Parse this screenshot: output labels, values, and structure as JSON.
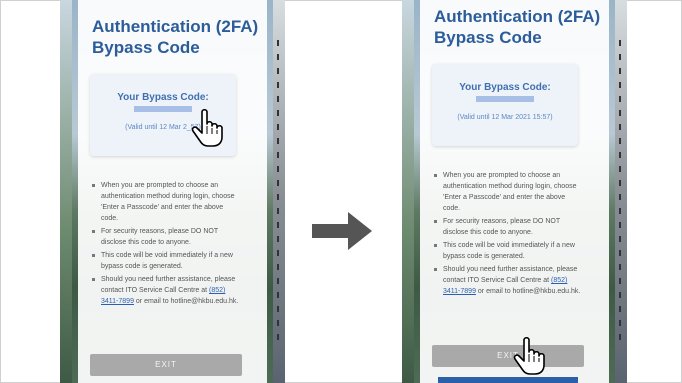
{
  "left_screen": {
    "title_line1": "Authentication (2FA)",
    "title_line2": "Bypass Code",
    "code_label": "Your Bypass Code:",
    "valid_text": "(Valid until 12 Mar 2_57)",
    "bullets": [
      "When you are prompted to choose an authentication method during login, choose 'Enter a Passcode' and enter the above code.",
      "For security reasons, please DO NOT disclose this code to anyone.",
      "This code will be void immediately if a new bypass code is generated."
    ],
    "assist_prefix": "Should you need further assistance, please contact ITO Service Call Centre at ",
    "phone_link": "(852) 3411-7899",
    "assist_suffix": " or email to hotline@hkbu.edu.hk.",
    "exit_label": "EXIT"
  },
  "right_screen": {
    "title_line1": "Authentication (2FA)",
    "title_line2": "Bypass Code",
    "code_label": "Your Bypass Code:",
    "valid_text": "(Valid until 12 Mar 2021 15:57)",
    "bullets": [
      "When you are prompted to choose an authentication method during login, choose 'Enter a Passcode' and enter the above code.",
      "For security reasons, please DO NOT disclose this code to anyone.",
      "This code will be void immediately if a new bypass code is generated."
    ],
    "assist_prefix": "Should you need further assistance, please contact ITO Service Call Centre at ",
    "phone_link": "(852) 3411-7899",
    "assist_suffix": " or email to hotline@hkbu.edu.hk.",
    "exit_label": "EXIT"
  },
  "colors": {
    "title": "#2c5d9a",
    "code_label": "#3f6fb0",
    "link": "#2d5fb0",
    "exit_button": "#a9a9a9",
    "arrow": "#555555"
  }
}
